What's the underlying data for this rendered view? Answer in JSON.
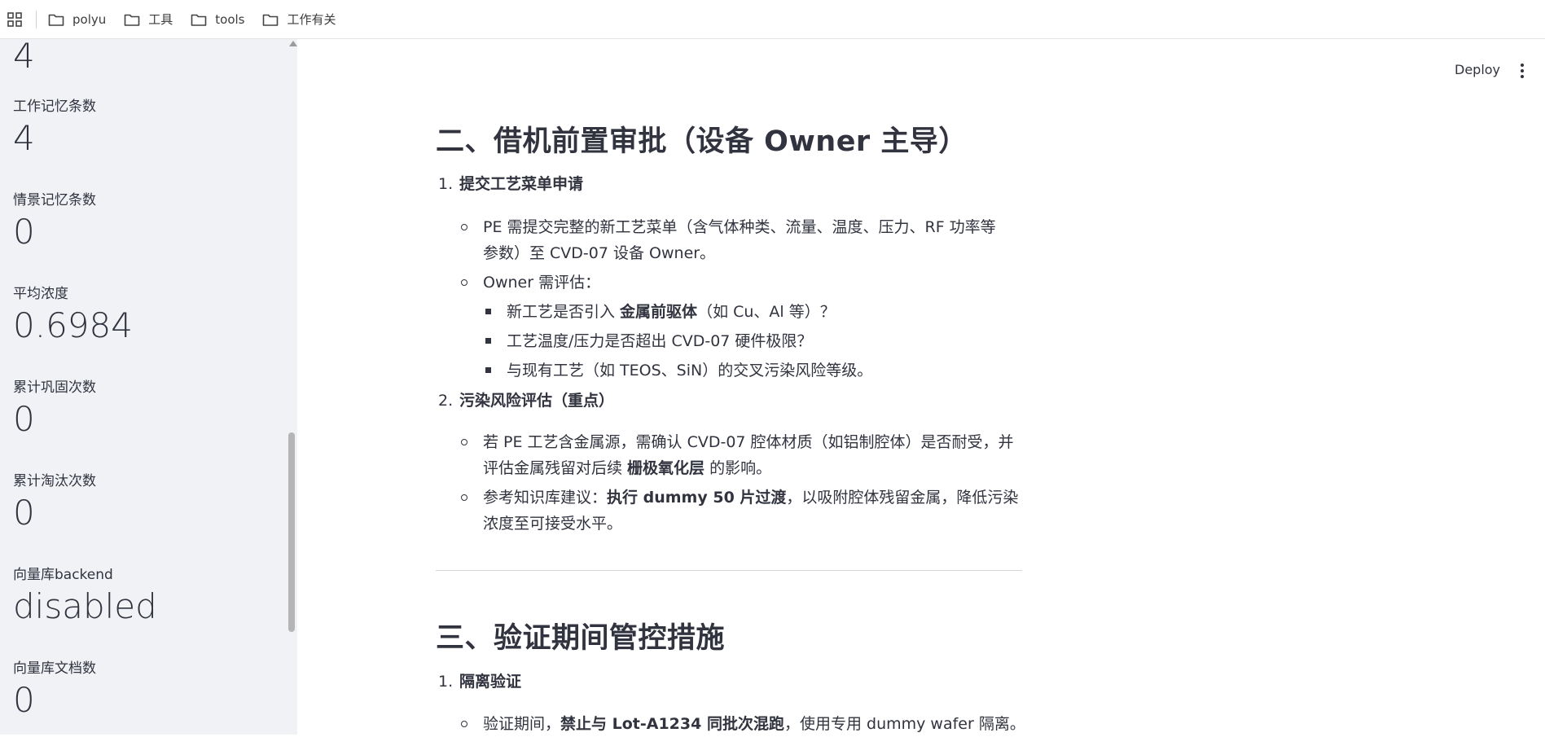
{
  "bookmarks": [
    {
      "label": "polyu",
      "icon": "folder-icon"
    },
    {
      "label": "工具",
      "icon": "folder-icon"
    },
    {
      "label": "tools",
      "icon": "folder-icon"
    },
    {
      "label": "工作有关",
      "icon": "folder-icon"
    }
  ],
  "sidebar": {
    "top_value": "4",
    "metrics": [
      {
        "label": "工作记忆条数",
        "value": "4"
      },
      {
        "label": "情景记忆条数",
        "value": "0"
      },
      {
        "label": "平均浓度",
        "value": "0.6984"
      },
      {
        "label": "累计巩固次数",
        "value": "0"
      },
      {
        "label": "累计淘汰次数",
        "value": "0"
      },
      {
        "label": "向量库backend",
        "value": "disabled"
      },
      {
        "label": "向量库文档数",
        "value": "0"
      }
    ]
  },
  "header": {
    "deploy_label": "Deploy",
    "menu_icon": "kebab-menu-icon"
  },
  "main": {
    "section2": {
      "title": "二、借机前置审批（设备 Owner 主导）",
      "item1": {
        "num": "1.",
        "title": "提交工艺菜单申请",
        "b1_line1": "PE 需提交完整的新工艺菜单（含气体种类、流量、温度、压力、RF 功率等",
        "b1_line2": "参数）至 CVD-07 设备 Owner。",
        "b2": "Owner 需评估：",
        "s1_pre": "新工艺是否引入 ",
        "s1_bold": "金属前驱体",
        "s1_post": "（如 Cu、Al 等）？",
        "s2": "工艺温度/压力是否超出 CVD-07 硬件极限？",
        "s3": "与现有工艺（如 TEOS、SiN）的交叉污染风险等级。"
      },
      "item2": {
        "num": "2.",
        "title": "污染风险评估（重点）",
        "b1_line1": "若 PE 工艺含金属源，需确认 CVD-07 腔体材质（如铝制腔体）是否耐受，并",
        "b1_line2_pre": "评估金属残留对后续 ",
        "b1_line2_bold": "栅极氧化层",
        "b1_line2_post": " 的影响。",
        "b2_pre": "参考知识库建议：",
        "b2_bold": "执行 dummy 50 片过渡",
        "b2_post": "，以吸附腔体残留金属，降低污染",
        "b2_line2": "浓度至可接受水平。"
      }
    },
    "section3": {
      "title": "三、验证期间管控措施",
      "item1": {
        "num": "1.",
        "title": "隔离验证",
        "b1_pre": "验证期间，",
        "b1_bold": "禁止与 Lot-A1234 同批次混跑",
        "b1_post": "，使用专用 dummy wafer 隔离。"
      }
    }
  }
}
